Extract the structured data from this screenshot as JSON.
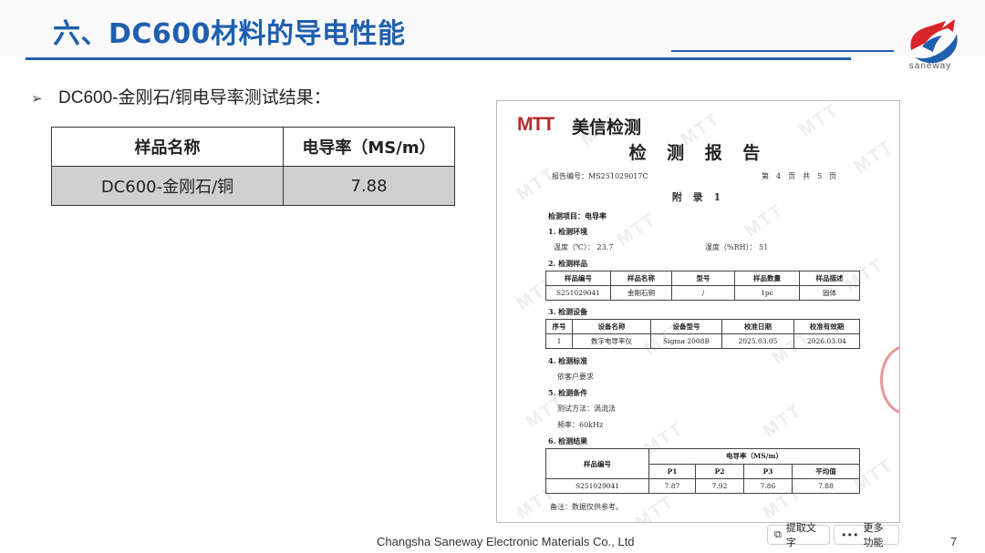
{
  "slide": {
    "title": "六、DC600材料的导电性能",
    "logo_text": "saneway",
    "bullet": "DC600-金刚石/铜电导率测试结果：",
    "table": {
      "headers": [
        "样品名称",
        "电导率（MS/m）"
      ],
      "rows": [
        [
          "DC600-金刚石/铜",
          "7.88"
        ]
      ]
    },
    "footer": "Changsha Saneway Electronic Materials Co., Ltd",
    "page_number": "7"
  },
  "report": {
    "logo_mark": "MTT",
    "logo_cn": "美信检测",
    "title": "检 测 报 告",
    "report_no_label": "报告编号：",
    "report_no": "MS251029017C",
    "page_info": "第　4　页　共　5　页",
    "appendix": "附 录 1",
    "item": "检测项目：电导率",
    "s1_title": "1. 检测环境",
    "temperature": "温度（℃）：  23.7",
    "humidity": "湿度（%RH）：  51",
    "s2_title": "2. 检测样品",
    "sample_headers": [
      "样品编号",
      "样品名称",
      "型号",
      "样品数量",
      "样品描述"
    ],
    "sample_row": [
      "S251029041",
      "金刚石铜",
      "/",
      "1pc",
      "固体"
    ],
    "s3_title": "3. 检测设备",
    "equip_headers": [
      "序号",
      "设备名称",
      "设备型号",
      "校准日期",
      "校准有效期"
    ],
    "equip_row": [
      "1",
      "数字电导率仪",
      "Sigma 2008B",
      "2025.03.05",
      "2026.03.04"
    ],
    "s4_title": "4. 检测标准",
    "standard": "依客户要求",
    "s5_title": "5. 检测条件",
    "method": "测试方法：涡流法",
    "frequency": "频率：60kHz",
    "s6_title": "6. 检测结果",
    "result_header_id": "样品编号",
    "result_header_group": "电导率（MS/m）",
    "result_subheaders": [
      "P1",
      "P2",
      "P3",
      "平均值"
    ],
    "result_row": [
      "S251029041",
      "7.87",
      "7.92",
      "7.86",
      "7.88"
    ],
    "note": "备注：数据仅供参考。",
    "watermark": "MTT"
  },
  "toolbar": {
    "extract_label": "提取文字",
    "more_label": "更多功能"
  }
}
